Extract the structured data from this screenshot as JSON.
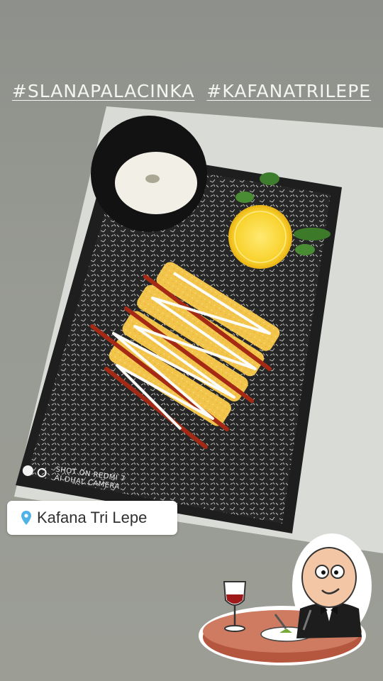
{
  "hashtags": [
    "#SLANAPALACINKA",
    "#KAFANATRILEPE"
  ],
  "camera_watermark": {
    "line1": "SHOT ON REDMI 7",
    "line2": "AI DUAL CAMERA"
  },
  "location_sticker": {
    "icon": "map-pin-icon",
    "label": "Kafana Tri Lepe",
    "pin_color": "#4fb3e8"
  },
  "sticker_chef": {
    "icon": "chef-dining-sticker"
  },
  "photo": {
    "description_icon": "food-photo"
  }
}
